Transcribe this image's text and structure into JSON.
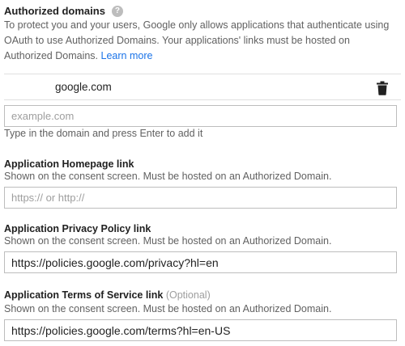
{
  "authorized_domains": {
    "title": "Authorized domains",
    "help_icon": "question-mark-icon",
    "description": "To protect you and your users, Google only allows applications that authenticate using OAuth to use Authorized Domains. Your applications' links must be hosted on Authorized Domains.",
    "learn_more": "Learn more",
    "domains": [
      {
        "name": "google.com",
        "delete_icon": "trash-icon"
      }
    ],
    "new_domain": {
      "value": "",
      "placeholder": "example.com",
      "hint": "Type in the domain and press Enter to add it"
    }
  },
  "homepage": {
    "label": "Application Homepage link",
    "hint": "Shown on the consent screen. Must be hosted on an Authorized Domain.",
    "value": "",
    "placeholder": "https:// or http://"
  },
  "privacy_policy": {
    "label": "Application Privacy Policy link",
    "hint": "Shown on the consent screen. Must be hosted on an Authorized Domain.",
    "value": "https://policies.google.com/privacy?hl=en",
    "placeholder": ""
  },
  "terms_of_service": {
    "label": "Application Terms of Service link",
    "optional": "(Optional)",
    "hint": "Shown on the consent screen. Must be hosted on an Authorized Domain.",
    "value": "https://policies.google.com/terms?hl=en-US",
    "placeholder": ""
  },
  "colors": {
    "link": "#1a73e8",
    "text": "#212121",
    "secondary_text": "#616161",
    "border": "#bdbdbd"
  }
}
